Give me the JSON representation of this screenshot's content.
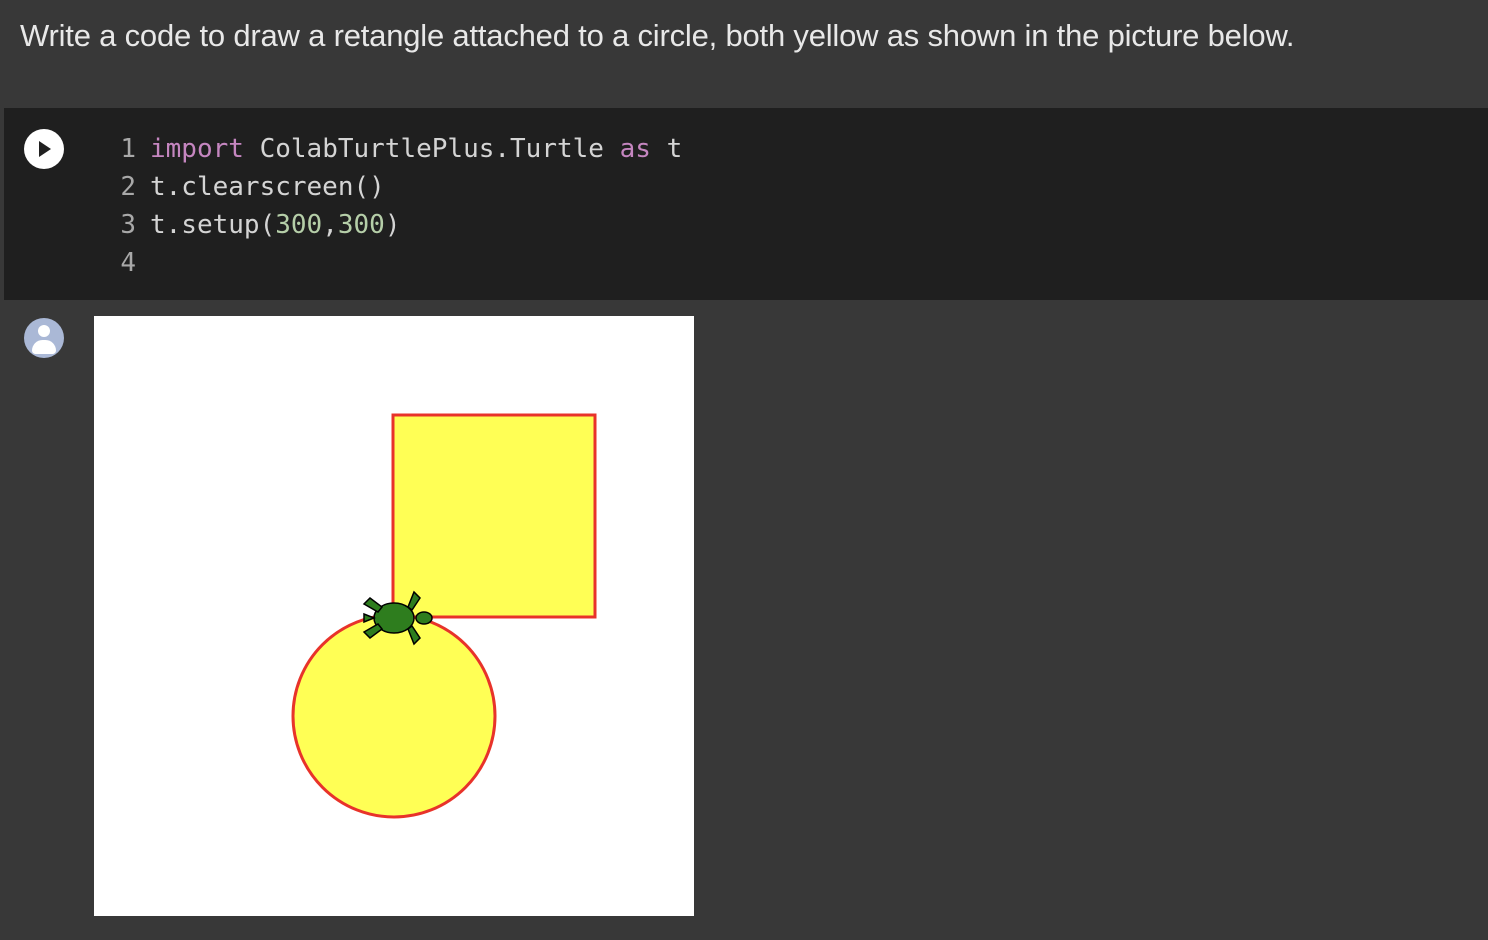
{
  "prompt": {
    "text": "Write a code to draw a retangle attached to a circle, both yellow as shown in the picture below."
  },
  "code_cell": {
    "run_icon": "play-icon",
    "lines": [
      {
        "num": "1",
        "parts": [
          {
            "t": "import",
            "c": "kw"
          },
          {
            "t": " ColabTurtlePlus.Turtle ",
            "c": ""
          },
          {
            "t": "as",
            "c": "kw"
          },
          {
            "t": " t",
            "c": ""
          }
        ]
      },
      {
        "num": "2",
        "parts": [
          {
            "t": "t.clearscreen()",
            "c": ""
          }
        ]
      },
      {
        "num": "3",
        "parts": [
          {
            "t": "t.setup(",
            "c": ""
          },
          {
            "t": "300",
            "c": "num"
          },
          {
            "t": ",",
            "c": ""
          },
          {
            "t": "300",
            "c": "num"
          },
          {
            "t": ")",
            "c": ""
          }
        ]
      },
      {
        "num": "4",
        "parts": []
      }
    ]
  },
  "output": {
    "avatar_icon": "user-avatar-icon",
    "drawing": {
      "fill_color": "#ffff55",
      "stroke_color": "#e8332a",
      "turtle_color": "#2e7d1e",
      "turtle_icon": "turtle-icon"
    }
  }
}
